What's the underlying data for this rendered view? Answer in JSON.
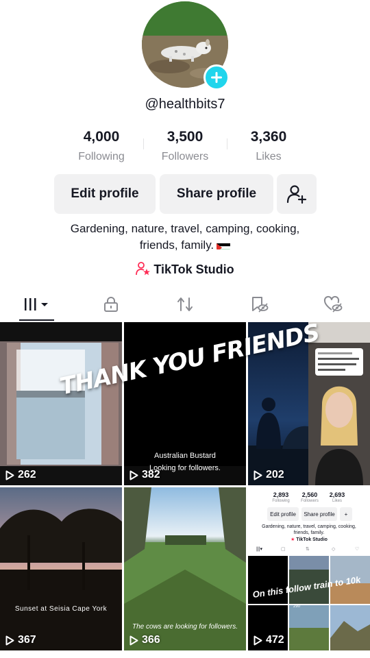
{
  "profile": {
    "username": "@healthbits7",
    "following_count": "4,000",
    "following_label": "Following",
    "followers_count": "3,500",
    "followers_label": "Followers",
    "likes_count": "3,360",
    "likes_label": "Likes",
    "bio_line1": "Gardening, nature, travel, camping, cooking,",
    "bio_line2": "friends, family.",
    "studio_label": "TikTok Studio"
  },
  "buttons": {
    "edit_profile": "Edit profile",
    "share_profile": "Share profile"
  },
  "tabs": [
    {
      "name": "videos",
      "icon": "grid-icon"
    },
    {
      "name": "private",
      "icon": "lock-icon"
    },
    {
      "name": "reposts",
      "icon": "repost-icon"
    },
    {
      "name": "favorites",
      "icon": "bookmark-eye-icon"
    },
    {
      "name": "liked",
      "icon": "heart-eye-icon"
    }
  ],
  "banner_text": "THANK YOU FRIENDS",
  "videos": [
    {
      "views": "262",
      "caption": ""
    },
    {
      "views": "382",
      "caption": "Australian Bustard",
      "caption2": "Looking for followers."
    },
    {
      "views": "202",
      "caption": ""
    },
    {
      "views": "",
      "caption": ""
    },
    {
      "views": "367",
      "caption": "Sunset at Seisia Cape York"
    },
    {
      "views": "366",
      "caption": "The cows are looking for followers."
    },
    {
      "views": "472",
      "caption": "On this follow train to 10k"
    }
  ],
  "mini_profile": {
    "following": "2,893",
    "following_label": "Following",
    "followers": "2,560",
    "followers_label": "Followers",
    "likes": "2,693",
    "likes_label": "Likes",
    "edit": "Edit profile",
    "share": "Share profile",
    "bio1": "Gardening, nature, travel, camping, cooking,",
    "bio2": "friends, family.",
    "studio": "TikTok Studio",
    "mini_views": "290"
  },
  "colors": {
    "accent": "#20d5ec",
    "studio_pink": "#fe2c55",
    "text_primary": "#161823",
    "text_secondary": "#8a8b91",
    "button_bg": "#f1f1f2"
  }
}
